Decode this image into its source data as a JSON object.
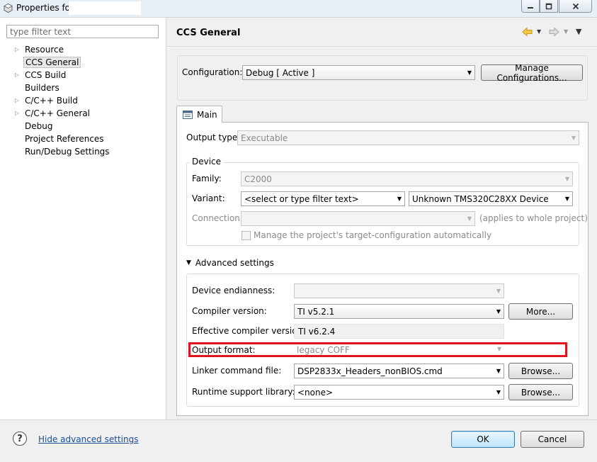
{
  "window": {
    "title": "Properties for",
    "title_suffix": "",
    "controls": {
      "minimize": "minimize-icon",
      "maximize": "maximize-icon",
      "close": "close-icon"
    }
  },
  "sidebar": {
    "filter_placeholder": "type filter text",
    "items": [
      {
        "label": "Resource",
        "expandable": true,
        "selected": false
      },
      {
        "label": "CCS General",
        "expandable": false,
        "selected": true
      },
      {
        "label": "CCS Build",
        "expandable": true,
        "selected": false
      },
      {
        "label": "Builders",
        "expandable": false,
        "selected": false
      },
      {
        "label": "C/C++ Build",
        "expandable": true,
        "selected": false
      },
      {
        "label": "C/C++ General",
        "expandable": true,
        "selected": false
      },
      {
        "label": "Debug",
        "expandable": false,
        "selected": false
      },
      {
        "label": "Project References",
        "expandable": false,
        "selected": false
      },
      {
        "label": "Run/Debug Settings",
        "expandable": false,
        "selected": false
      }
    ]
  },
  "header": {
    "title": "CCS General",
    "nav_icons": [
      "back-arrow-icon",
      "forward-arrow-icon",
      "view-menu-icon"
    ]
  },
  "configuration": {
    "label": "Configuration:",
    "value": "Debug  [ Active ]",
    "manage_button": "Manage Configurations..."
  },
  "tabs": [
    {
      "label": "Main",
      "icon": "main-tab-icon",
      "active": true
    }
  ],
  "main": {
    "output_type": {
      "label": "Output type:",
      "value": "Executable"
    },
    "device": {
      "legend": "Device",
      "family": {
        "label": "Family:",
        "value": "C2000"
      },
      "variant": {
        "label": "Variant:",
        "filter_placeholder": "<select or type filter text>",
        "value": "Unknown TMS320C28XX Device"
      },
      "connection": {
        "label": "Connection:",
        "value": "",
        "note": "(applies to whole project)"
      },
      "manage_checkbox": {
        "label": "Manage the project's target-configuration automatically",
        "checked": false
      }
    },
    "advanced": {
      "toggle_label": "Advanced settings",
      "endianness": {
        "label": "Device endianness:",
        "value": ""
      },
      "compiler_version": {
        "label": "Compiler version:",
        "value": "TI v5.2.1",
        "button": "More..."
      },
      "effective_compiler": {
        "label": "Effective compiler version:",
        "value": "TI v6.2.4"
      },
      "output_format": {
        "label": "Output format:",
        "value": "legacy COFF",
        "highlight_color": "#e0141e"
      },
      "linker_command_file": {
        "label": "Linker command file:",
        "value": "DSP2833x_Headers_nonBIOS.cmd",
        "button": "Browse..."
      },
      "runtime_library": {
        "label": "Runtime support library:",
        "value": "<none>",
        "button": "Browse..."
      }
    }
  },
  "footer": {
    "help_icon": "help-icon",
    "hide_advanced_link": "Hide advanced settings",
    "ok_button": "OK",
    "cancel_button": "Cancel"
  }
}
